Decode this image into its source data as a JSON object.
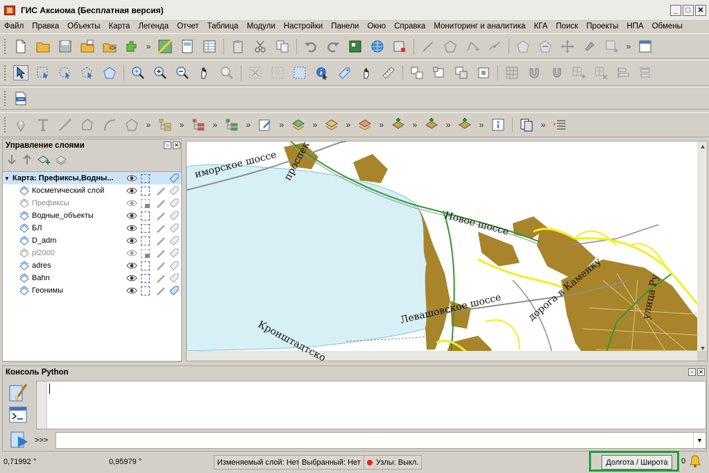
{
  "window": {
    "title": "ГИС Аксиома (Бесплатная версия)",
    "minimize": "_",
    "maximize": "□",
    "close": "✕"
  },
  "menu": [
    "Файл",
    "Правка",
    "Объекты",
    "Карта",
    "Легенда",
    "Отчет",
    "Таблица",
    "Модули",
    "Настройки",
    "Панели",
    "Окно",
    "Справка",
    "Мониторинг и аналитика",
    "КГА",
    "Поиск",
    "Проекты",
    "НПА",
    "Обмены"
  ],
  "toolbar": {
    "more": "»"
  },
  "layers_panel": {
    "title": "Управление слоями",
    "map_group": "Карта: Префиксы,Водны...",
    "layers": [
      {
        "name": "Косметический слой",
        "enabled": true
      },
      {
        "name": "Префиксы",
        "enabled": false
      },
      {
        "name": "Водные_объекты",
        "enabled": true
      },
      {
        "name": "БЛ",
        "enabled": true
      },
      {
        "name": "D_adm",
        "enabled": true
      },
      {
        "name": "pl2000",
        "enabled": false
      },
      {
        "name": "adres",
        "enabled": true
      },
      {
        "name": "Bahn",
        "enabled": true
      },
      {
        "name": "Геонимы",
        "enabled": true
      }
    ]
  },
  "map": {
    "labels": [
      {
        "text": "иморское шоссе"
      },
      {
        "text": "проспек"
      },
      {
        "text": "Новое шоссе"
      },
      {
        "text": "Левашовское шоссе"
      },
      {
        "text": "дорога в Каменку"
      },
      {
        "text": "Кронштадтско"
      },
      {
        "text": "улица Ру"
      }
    ],
    "colors": {
      "water": "#d7f0f6",
      "built": "#a8842a",
      "road": "#8e8e8e",
      "boundary": "#f4ee1e",
      "green": "#2e9a2e"
    }
  },
  "console": {
    "title": "Консоль Python",
    "prompt": ">>>"
  },
  "status": {
    "longitude": "0,71992 °",
    "latitude": "0,95979 °",
    "editable_layer": "Изменяемый слой: Нет",
    "selected": "Выбранный: Нет",
    "nodes": "Узлы: Выкл.",
    "lonlat_button": "Долгота / Широта",
    "notifications": "0"
  }
}
